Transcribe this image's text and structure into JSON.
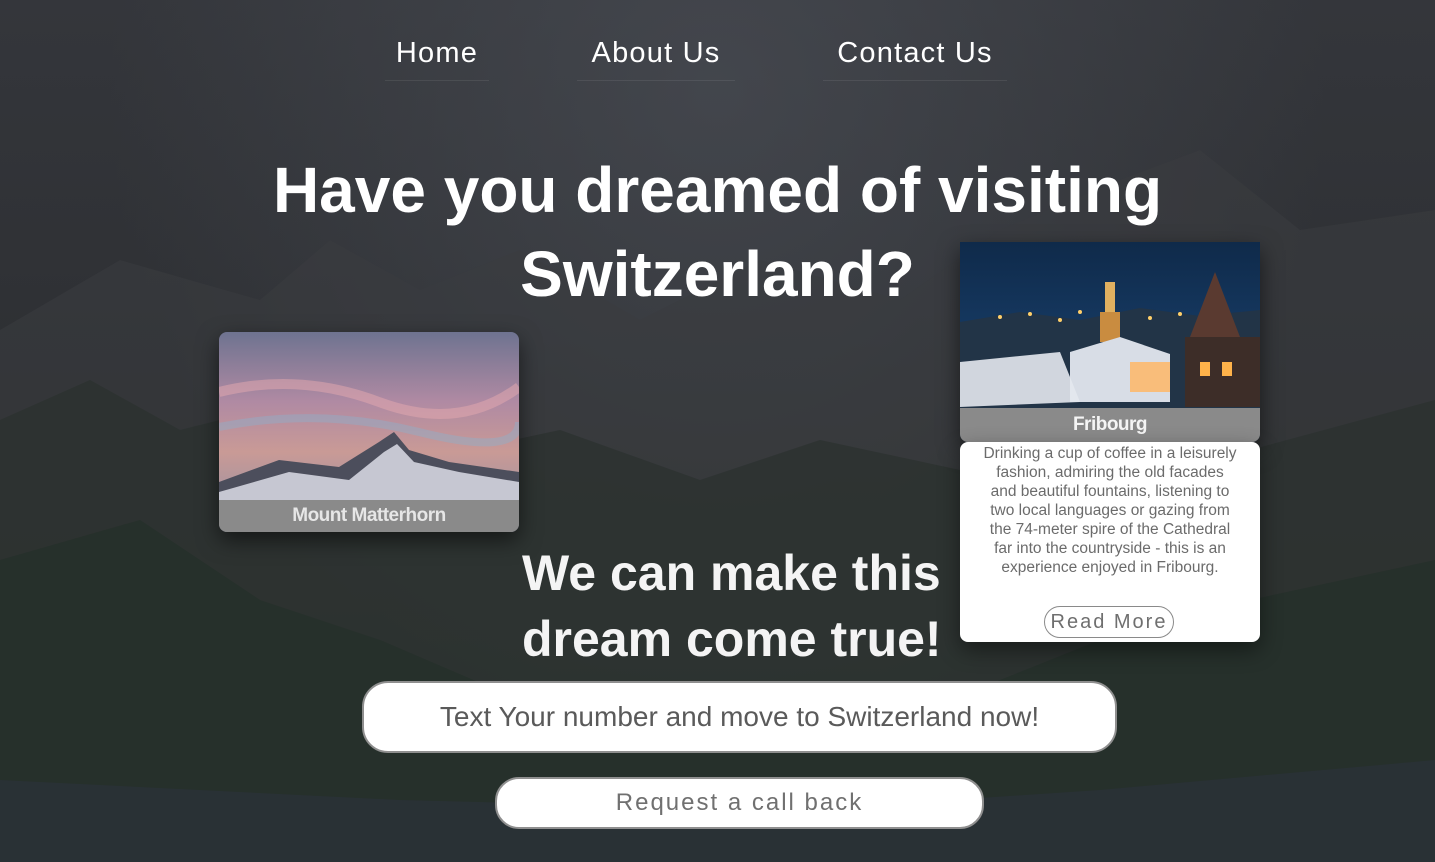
{
  "nav": {
    "home": "Home",
    "about": "About Us",
    "contact": "Contact Us"
  },
  "hero": {
    "title": "Have you dreamed of visiting Switzerland?",
    "subtitle": "We can make this dream come true!"
  },
  "cards": {
    "matterhorn": {
      "caption": "Mount Matterhorn"
    },
    "fribourg": {
      "caption": "Fribourg",
      "description": "Drinking a cup of coffee in a leisurely fashion, admiring the old facades and beautiful fountains, listening to two local languages or gazing from the 74-meter spire of the Cathedral far into the countryside - this is an experience enjoyed in Fribourg.",
      "read_more": "Read More"
    }
  },
  "contact_form": {
    "placeholder": "Text Your number and move to Switzerland now!",
    "button": "Request a call back"
  },
  "colors": {
    "background": "#2b2d31",
    "caption_bar": "#8a8a8a",
    "text_light": "#ffffff"
  }
}
